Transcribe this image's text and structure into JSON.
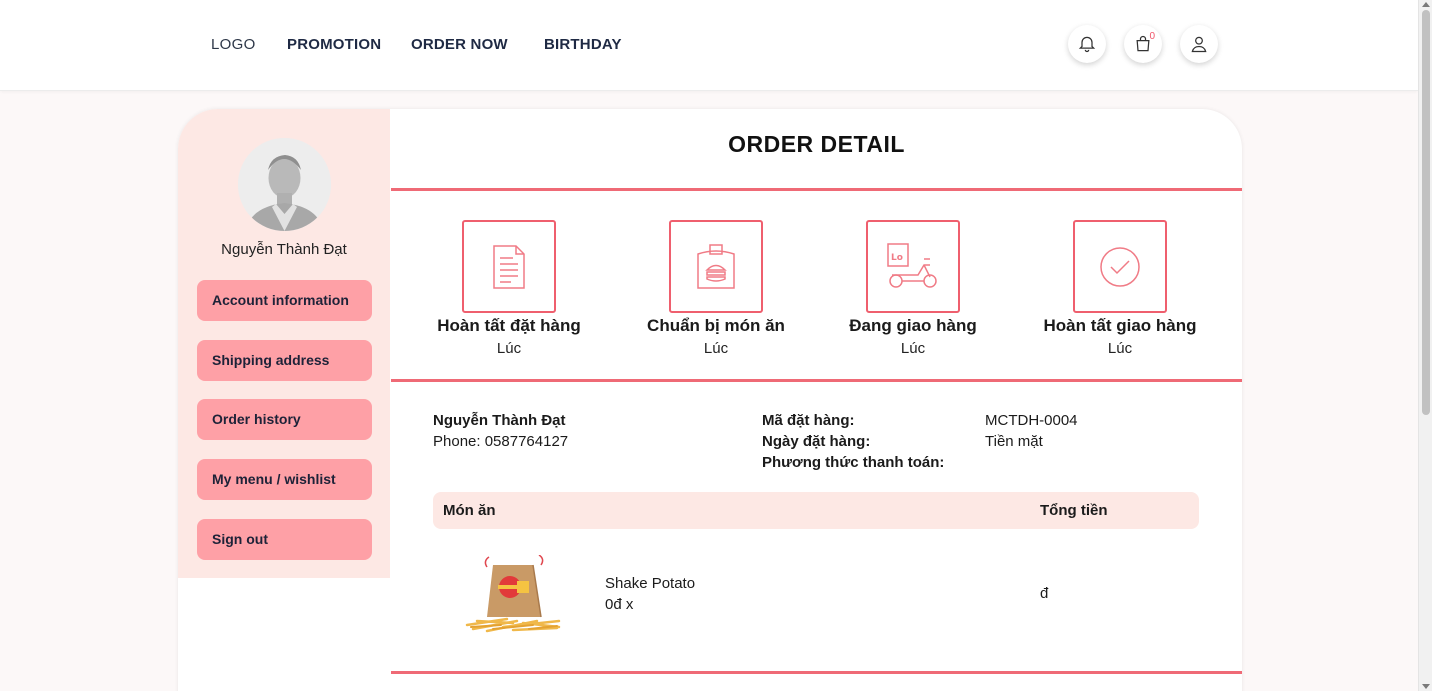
{
  "nav": {
    "logo": "LOGO",
    "links": [
      "PROMOTION",
      "ORDER NOW",
      "BIRTHDAY"
    ],
    "cart_count": "0",
    "icons": [
      "bell-icon",
      "cart-icon",
      "user-icon"
    ]
  },
  "sidebar": {
    "user_name": "Nguyễn Thành Đạt",
    "menu": [
      "Account information",
      "Shipping address",
      "Order history",
      "My menu / wishlist",
      "Sign out"
    ]
  },
  "order": {
    "title": "ORDER DETAIL",
    "steps": [
      {
        "label": "Hoàn tất đặt hàng",
        "time": "Lúc",
        "icon": "document-icon"
      },
      {
        "label": "Chuẩn bị món ăn",
        "time": "Lúc",
        "icon": "food-bag-icon"
      },
      {
        "label": "Đang giao hàng",
        "time": "Lúc",
        "icon": "delivery-scooter-icon"
      },
      {
        "label": "Hoàn tất giao hàng",
        "time": "Lúc",
        "icon": "check-circle-icon"
      }
    ],
    "customer_name": "Nguyễn Thành Đạt",
    "phone": "Phone: 0587764127",
    "order_code_label": "Mã đặt hàng:",
    "order_date_label": "Ngày đặt hàng:",
    "payment_label": "Phương thức thanh toán:",
    "order_code": "MCTDH-0004",
    "payment_value": "Tiền mặt",
    "table": {
      "col_item": "Món ăn",
      "col_total": "Tổng tiền"
    },
    "items": [
      {
        "name": "Shake Potato",
        "price_qty": "0đ x",
        "total": "đ"
      }
    ]
  },
  "colors": {
    "accent_red": "#ef6a76",
    "sidebar_bg": "#fde8e4",
    "button_pink": "#fea0a6"
  }
}
